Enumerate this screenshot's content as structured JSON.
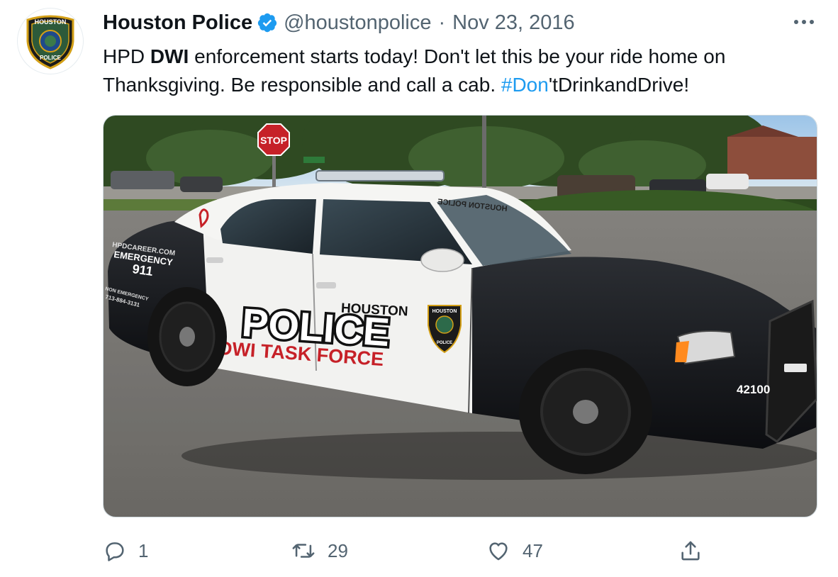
{
  "tweet": {
    "author_name": "Houston Police",
    "handle": "@houstonpolice",
    "separator": "·",
    "date": "Nov 23, 2016",
    "text_prefix": "HPD ",
    "text_bold": "DWI",
    "text_mid": " enforcement starts today! Don't let this be your ride home on Thanksgiving.  Be responsible and call a cab. ",
    "hashtag": "#Don",
    "text_suffix": "'tDrinkandDrive!"
  },
  "avatar": {
    "badge_top": "HOUSTON",
    "badge_bottom": "POLICE"
  },
  "photo": {
    "stop_sign": "STOP",
    "door_small": "HOUSTON",
    "door_big": "POLICE",
    "door_red": "DWI TASK FORCE",
    "rear_web": "HPDCAREER.COM",
    "rear_emergency": "EMERGENCY",
    "rear_number": "911",
    "rear_non_emergency": "NON EMERGENCY",
    "rear_phone": "713-884-3131",
    "hood_text": "HOUSTON POLICE",
    "unit_number": "42100",
    "badge_top": "HOUSTON",
    "badge_bottom": "POLICE"
  },
  "actions": {
    "replies": "1",
    "retweets": "29",
    "likes": "47"
  },
  "colors": {
    "accent": "#1d9bf0",
    "secondary_text": "#536471",
    "police_red": "#c62128"
  }
}
